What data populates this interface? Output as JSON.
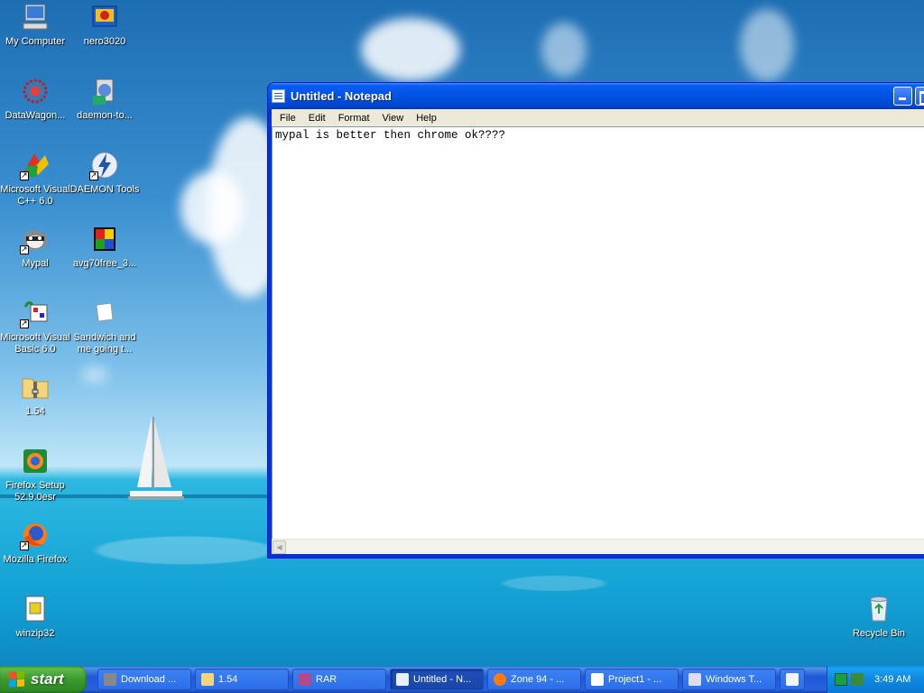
{
  "desktop": {
    "icons": [
      {
        "label": "My Computer"
      },
      {
        "label": "nero3020"
      },
      {
        "label": "DataWagon..."
      },
      {
        "label": "daemon-to..."
      },
      {
        "label": "Microsoft Visual\nC++ 6.0"
      },
      {
        "label": "DAEMON Tools"
      },
      {
        "label": "Mypal"
      },
      {
        "label": "avg70free_3..."
      },
      {
        "label": "Microsoft Visual\nBasic 6.0"
      },
      {
        "label": "Sandwich and\nme going t..."
      },
      {
        "label": "1.54"
      },
      {
        "label": "Firefox Setup\n52.9.0esr"
      },
      {
        "label": "Mozilla Firefox"
      },
      {
        "label": "winzip32"
      },
      {
        "label": "Recycle Bin"
      }
    ]
  },
  "notepad": {
    "title": "Untitled - Notepad",
    "menu": [
      "File",
      "Edit",
      "Format",
      "View",
      "Help"
    ],
    "content": "mypal is better then chrome ok????"
  },
  "taskbar": {
    "start_label": "start",
    "tasks": [
      {
        "label": "Download ..."
      },
      {
        "label": "1.54"
      },
      {
        "label": "RAR"
      },
      {
        "label": "Untitled - N..."
      },
      {
        "label": "Zone 94 - ..."
      },
      {
        "label": "Project1 - ..."
      },
      {
        "label": "Windows T..."
      }
    ],
    "clock": "3:49 AM"
  }
}
